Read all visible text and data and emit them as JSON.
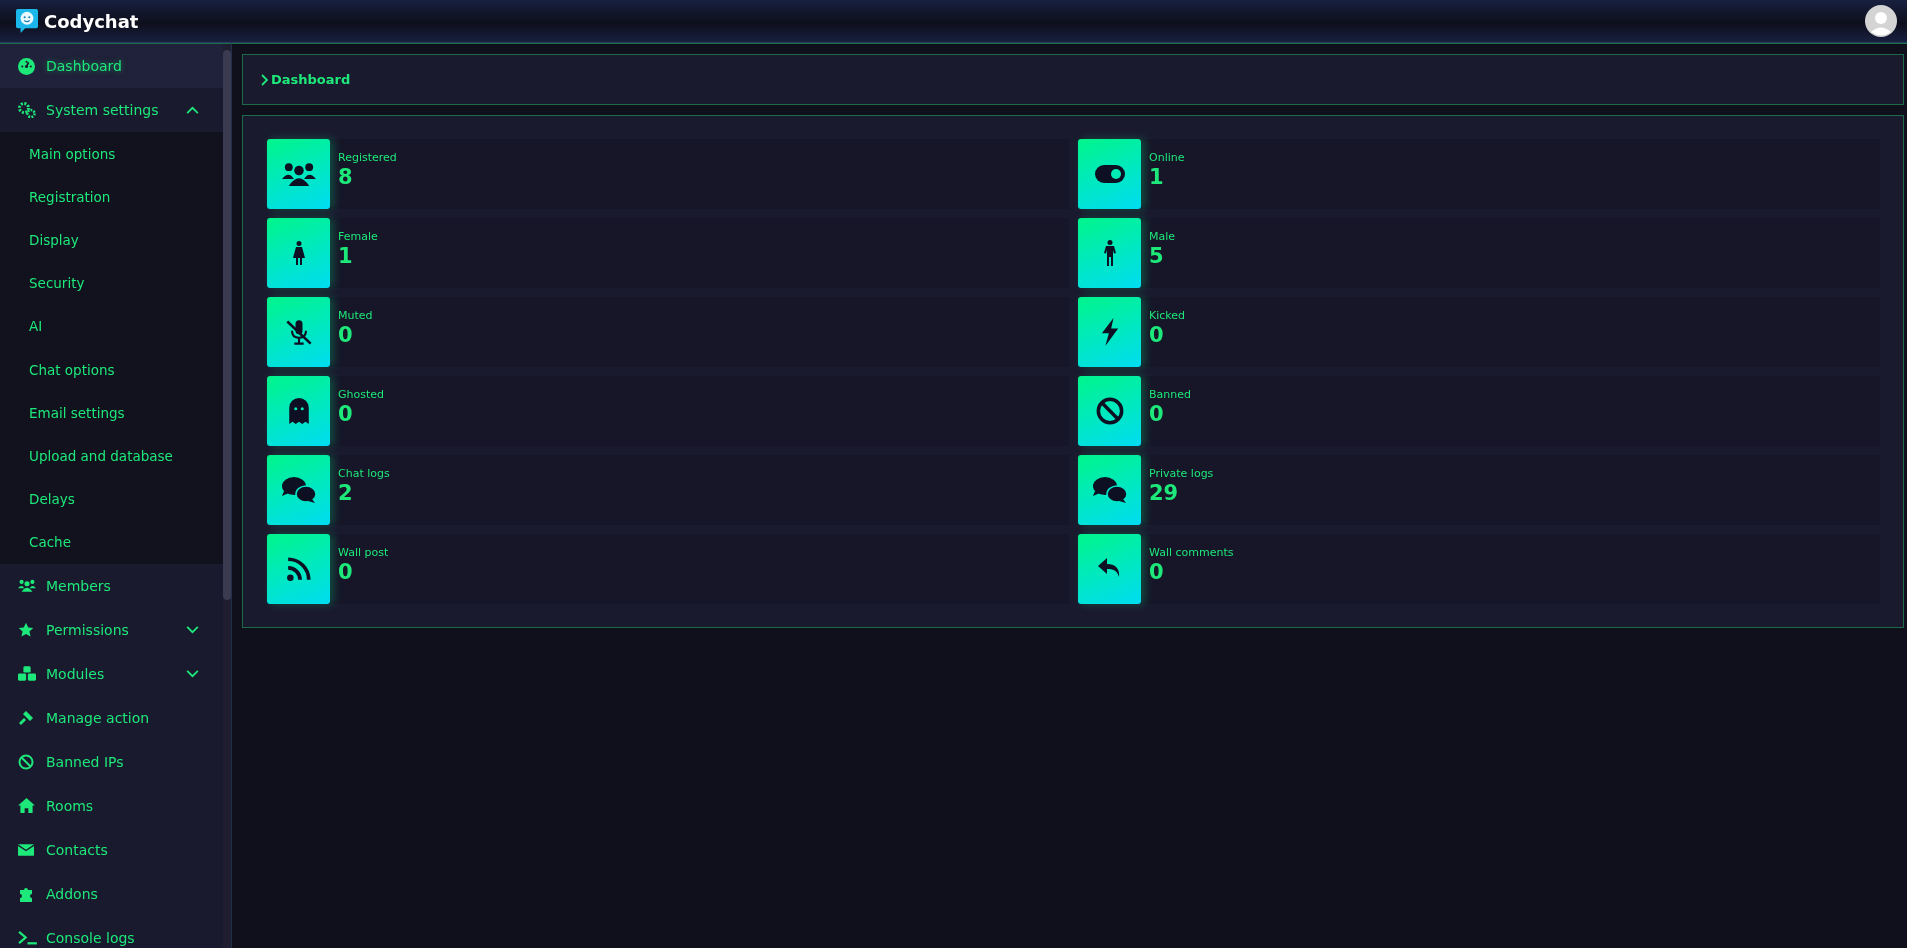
{
  "header": {
    "brand": "Codychat"
  },
  "sidebar": {
    "items": [
      {
        "label": "Dashboard",
        "selected": true
      },
      {
        "label": "System settings",
        "selected": false,
        "expanded": true,
        "children": [
          {
            "label": "Main options",
            "selected": false
          },
          {
            "label": "Registration",
            "selected": false
          },
          {
            "label": "Display",
            "selected": false
          },
          {
            "label": "Security",
            "selected": false
          },
          {
            "label": "AI",
            "selected": false
          },
          {
            "label": "Chat options",
            "selected": false
          },
          {
            "label": "Email settings",
            "selected": false
          },
          {
            "label": "Upload and database",
            "selected": false
          },
          {
            "label": "Delays",
            "selected": false
          },
          {
            "label": "Cache",
            "selected": false
          }
        ]
      },
      {
        "label": "Members",
        "selected": false
      },
      {
        "label": "Permissions",
        "selected": false,
        "expanded": false
      },
      {
        "label": "Modules",
        "selected": false,
        "expanded": false
      },
      {
        "label": "Manage action",
        "selected": false
      },
      {
        "label": "Banned IPs",
        "selected": false
      },
      {
        "label": "Rooms",
        "selected": false
      },
      {
        "label": "Contacts",
        "selected": false
      },
      {
        "label": "Addons",
        "selected": false
      },
      {
        "label": "Console logs",
        "selected": false
      }
    ]
  },
  "breadcrumb": "Dashboard",
  "stats": [
    {
      "label": "Registered",
      "value": "8"
    },
    {
      "label": "Online",
      "value": "1"
    },
    {
      "label": "Female",
      "value": "1"
    },
    {
      "label": "Male",
      "value": "5"
    },
    {
      "label": "Muted",
      "value": "0"
    },
    {
      "label": "Kicked",
      "value": "0"
    },
    {
      "label": "Ghosted",
      "value": "0"
    },
    {
      "label": "Banned",
      "value": "0"
    },
    {
      "label": "Chat logs",
      "value": "2"
    },
    {
      "label": "Private logs",
      "value": "29"
    },
    {
      "label": "Wall post",
      "value": "0"
    },
    {
      "label": "Wall comments",
      "value": "0"
    }
  ]
}
